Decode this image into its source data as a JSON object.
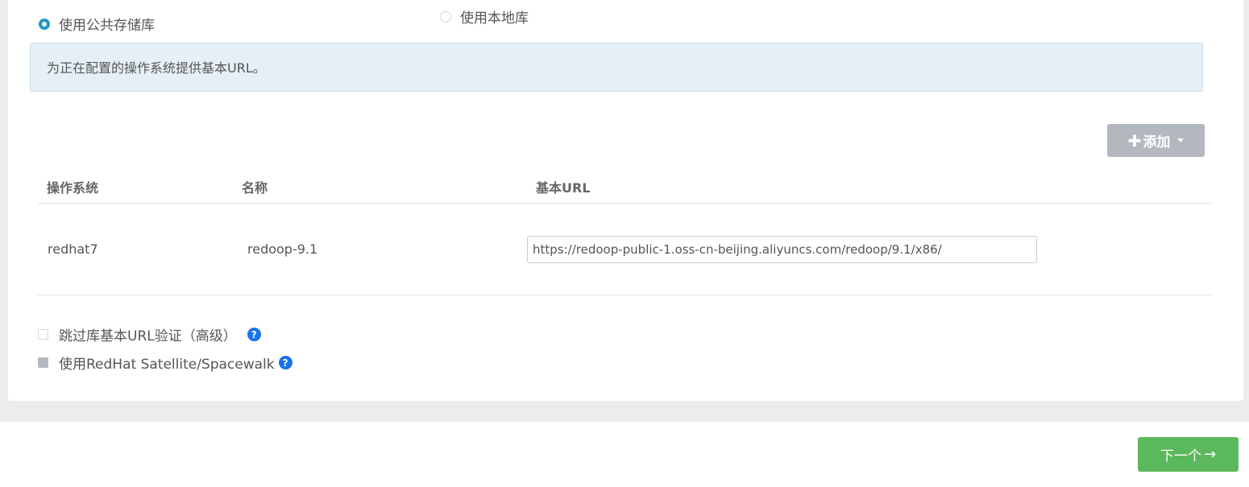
{
  "repo_choice": {
    "public_label": "使用公共存储库",
    "public_selected": true,
    "local_label": "使用本地库",
    "local_selected": false
  },
  "info": {
    "text": "为正在配置的操作系统提供基本URL。"
  },
  "toolbar": {
    "add_label": "添加",
    "add_icon": "plus-icon"
  },
  "table": {
    "headers": [
      "操作系统",
      "名称",
      "基本URL"
    ],
    "rows": [
      {
        "os": "redhat7",
        "name": "redoop-9.1",
        "base_url": "https://redoop-public-1.oss-cn-beijing.aliyuncs.com/redoop/9.1/x86/"
      }
    ]
  },
  "options": {
    "skip_validation_label": "跳过库基本URL验证（高级）",
    "skip_validation_checked": false,
    "satellite_label": "使用RedHat Satellite/Spacewalk",
    "satellite_checked": false,
    "help_icon": "question-circle-icon"
  },
  "footer": {
    "next_label": "下一个",
    "next_arrow": "→"
  },
  "colors": {
    "accent": "#1f98c4",
    "info_bg": "#e5f0f6",
    "disabled_button": "#b3b8bf",
    "success_button": "#5cb85c",
    "help_icon": "#1a73e8"
  }
}
